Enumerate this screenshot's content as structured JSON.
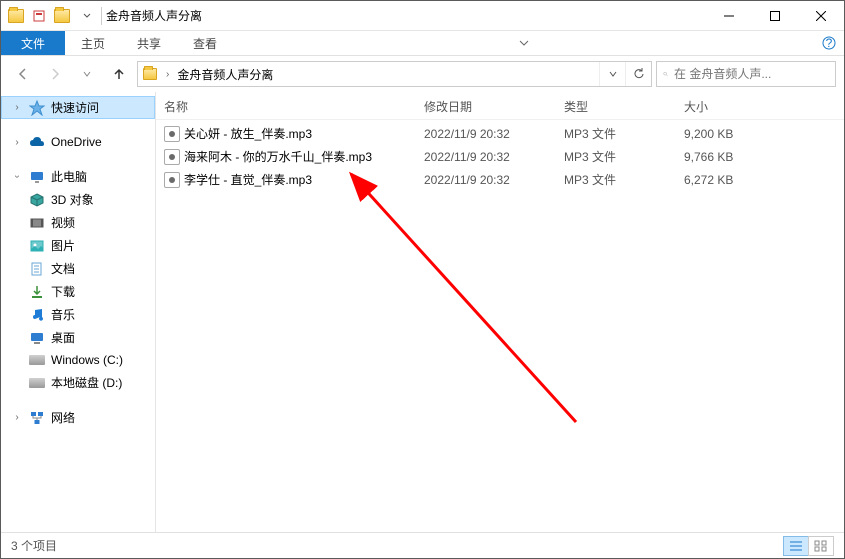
{
  "window": {
    "title": "金舟音频人声分离"
  },
  "ribbon": {
    "file": "文件",
    "home": "主页",
    "share": "共享",
    "view": "查看"
  },
  "address": {
    "segment1": "金舟音频人声分离"
  },
  "search": {
    "placeholder": "在 金舟音频人声..."
  },
  "sidebar": {
    "quick_access": "快速访问",
    "onedrive": "OneDrive",
    "this_pc": "此电脑",
    "objects_3d": "3D 对象",
    "videos": "视频",
    "pictures": "图片",
    "documents": "文档",
    "downloads": "下载",
    "music": "音乐",
    "desktop": "桌面",
    "drive_c": "Windows (C:)",
    "drive_d": "本地磁盘 (D:)",
    "network": "网络"
  },
  "columns": {
    "name": "名称",
    "date": "修改日期",
    "type": "类型",
    "size": "大小"
  },
  "files": [
    {
      "name": "关心妍 - 放生_伴奏.mp3",
      "date": "2022/11/9 20:32",
      "type": "MP3 文件",
      "size": "9,200 KB"
    },
    {
      "name": "海来阿木 - 你的万水千山_伴奏.mp3",
      "date": "2022/11/9 20:32",
      "type": "MP3 文件",
      "size": "9,766 KB"
    },
    {
      "name": "李学仕 - 直觉_伴奏.mp3",
      "date": "2022/11/9 20:32",
      "type": "MP3 文件",
      "size": "6,272 KB"
    }
  ],
  "status": {
    "count": "3 个项目"
  }
}
